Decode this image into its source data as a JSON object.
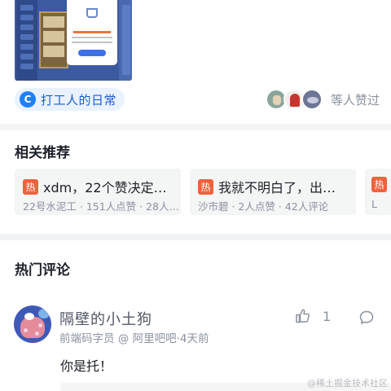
{
  "article": {
    "topic": {
      "icon_letter": "C",
      "icon": "topic-c-icon",
      "label": "打工人的日常"
    },
    "likes": {
      "avatars": [
        "user-avatar-1",
        "user-avatar-2",
        "user-avatar-3"
      ],
      "text": "等人赞过"
    }
  },
  "related": {
    "title": "相关推荐",
    "items": [
      {
        "badge": "热",
        "title": "xdm，22个赞决定…",
        "meta": "22号水泥工 · 151人点赞 · 28人…"
      },
      {
        "badge": "热",
        "title": "我就不明白了，出…",
        "meta": "沙市碧 · 2人点赞 · 42人评论"
      },
      {
        "badge": "热",
        "title": "",
        "meta": "L"
      }
    ]
  },
  "comments": {
    "title": "热门评论",
    "items": [
      {
        "author": "隔壁的小土狗",
        "meta": "前端码字员 @ 阿里吧吧·4天前",
        "likes": "1",
        "text": "你是托！"
      }
    ]
  },
  "watermark": "@稀土掘金技术社区",
  "colors": {
    "accent": "#1e80ff",
    "hot_badge": "#f0623d",
    "muted_text": "#8a919f"
  }
}
